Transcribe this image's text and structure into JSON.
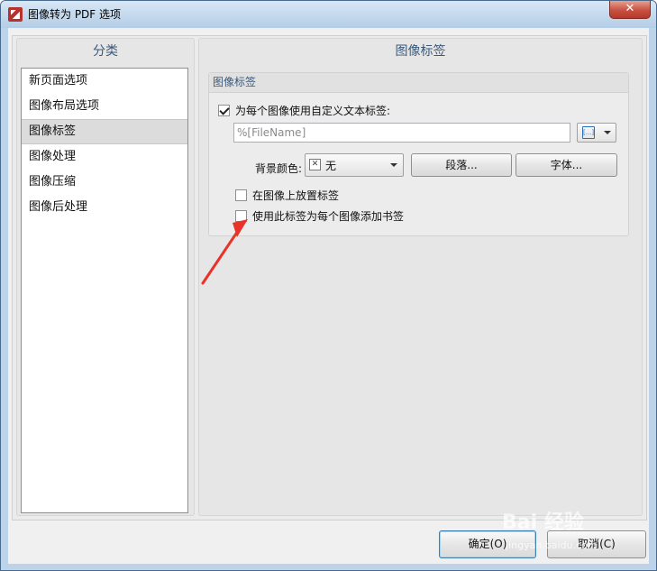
{
  "window": {
    "title": "图像转为 PDF 选项",
    "close_label": "✕"
  },
  "left_pane": {
    "header": "分类",
    "items": [
      {
        "label": "新页面选项"
      },
      {
        "label": "图像布局选项"
      },
      {
        "label": "图像标签",
        "selected": true
      },
      {
        "label": "图像处理"
      },
      {
        "label": "图像压缩"
      },
      {
        "label": "图像后处理"
      }
    ]
  },
  "right_pane": {
    "header": "图像标签",
    "group_title": "图像标签",
    "use_custom_label": {
      "label": "为每个图像使用自定义文本标签:",
      "checked": true
    },
    "label_text": {
      "value": "%[FileName]"
    },
    "macro_button": {
      "icon": "macro-insert-icon",
      "glyph": "[...]"
    },
    "bg_color": {
      "label": "背景颜色:",
      "value": "无",
      "swatch_glyph": "✕"
    },
    "paragraph_button": "段落...",
    "font_button": "字体...",
    "place_on_image": {
      "label": "在图像上放置标签",
      "checked": false
    },
    "add_bookmark": {
      "label": "使用此标签为每个图像添加书签",
      "checked": false
    }
  },
  "footer": {
    "ok_label": "确定(O)",
    "cancel_label": "取消(C)"
  },
  "watermark": {
    "text": "Bai 经验",
    "sub": "jingyan.baidu.com"
  },
  "colors": {
    "arrow": "#e8332a",
    "header_text": "#3b5a7b",
    "frame": "#bcd3ea"
  }
}
